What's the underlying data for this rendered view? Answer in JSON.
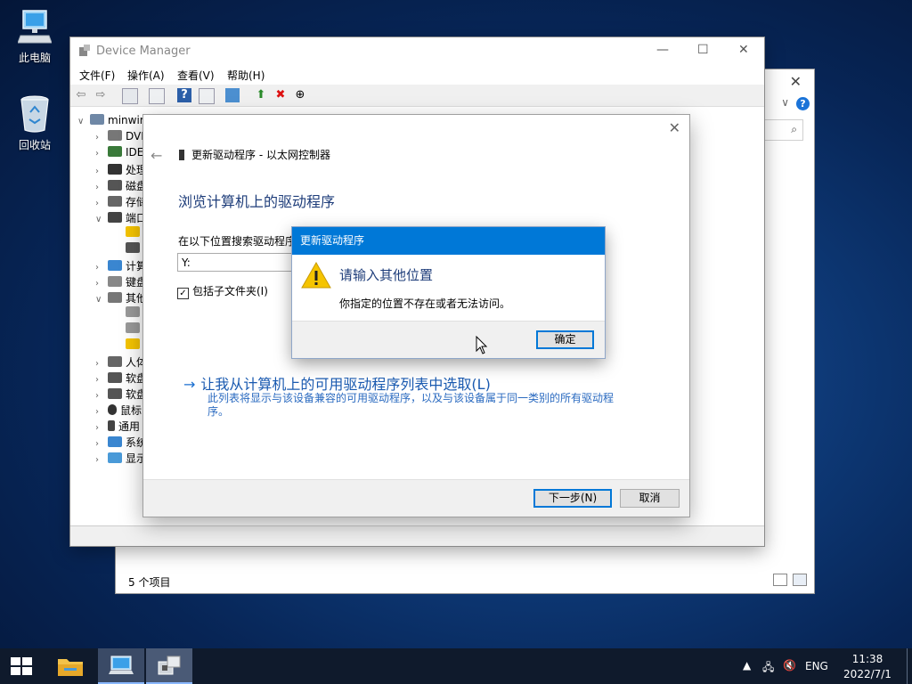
{
  "desktop": {
    "icons": [
      {
        "label": "此电脑",
        "icon": "computer-icon"
      },
      {
        "label": "回收站",
        "icon": "recycle-bin-icon"
      }
    ]
  },
  "explorer": {
    "status_text": "5 个项目",
    "close_glyph": "✕"
  },
  "device_manager": {
    "title": "Device Manager",
    "menu": [
      "文件(F)",
      "操作(A)",
      "查看(V)",
      "帮助(H)"
    ],
    "tree": [
      {
        "label": "minwir",
        "expander": "∨"
      },
      {
        "label": "DVD",
        "expander": "›"
      },
      {
        "label": "IDE",
        "expander": "›"
      },
      {
        "label": "处理",
        "expander": "›"
      },
      {
        "label": "磁盘",
        "expander": "›"
      },
      {
        "label": "存储",
        "expander": "›"
      },
      {
        "label": "端口",
        "expander": "∨"
      },
      {
        "label": "",
        "expander": ""
      },
      {
        "label": "",
        "expander": ""
      },
      {
        "label": "计算",
        "expander": "›"
      },
      {
        "label": "键盘",
        "expander": "›"
      },
      {
        "label": "其他",
        "expander": "∨"
      },
      {
        "label": "",
        "expander": ""
      },
      {
        "label": "",
        "expander": ""
      },
      {
        "label": "",
        "expander": ""
      },
      {
        "label": "人体",
        "expander": "›"
      },
      {
        "label": "软盘",
        "expander": "›"
      },
      {
        "label": "软盘",
        "expander": "›"
      },
      {
        "label": "鼠标",
        "expander": "›"
      },
      {
        "label": "通用",
        "expander": "›"
      },
      {
        "label": "系统",
        "expander": "›"
      },
      {
        "label": "显示",
        "expander": "›"
      }
    ]
  },
  "wizard": {
    "header": "更新驱动程序 - 以太网控制器",
    "heading": "浏览计算机上的驱动程序",
    "search_label": "在以下位置搜索驱动程序",
    "path_value": "Y:",
    "include_subfolders": "包括子文件夹(I)",
    "pick_link": "让我从计算机上的可用驱动程序列表中选取(L)",
    "pick_desc": "此列表将显示与该设备兼容的可用驱动程序，以及与该设备属于同一类别的所有驱动程序。",
    "next_button": "下一步(N)",
    "cancel_button": "取消"
  },
  "msgbox": {
    "title": "更新驱动程序",
    "heading": "请输入其他位置",
    "message": "你指定的位置不存在或者无法访问。",
    "ok_button": "确定"
  },
  "taskbar": {
    "tray_language": "ENG",
    "time": "11:38",
    "date": "2022/7/1"
  },
  "colors": {
    "accent": "#0078d7",
    "link": "#1a5ab0",
    "warning": "#f5c400"
  }
}
